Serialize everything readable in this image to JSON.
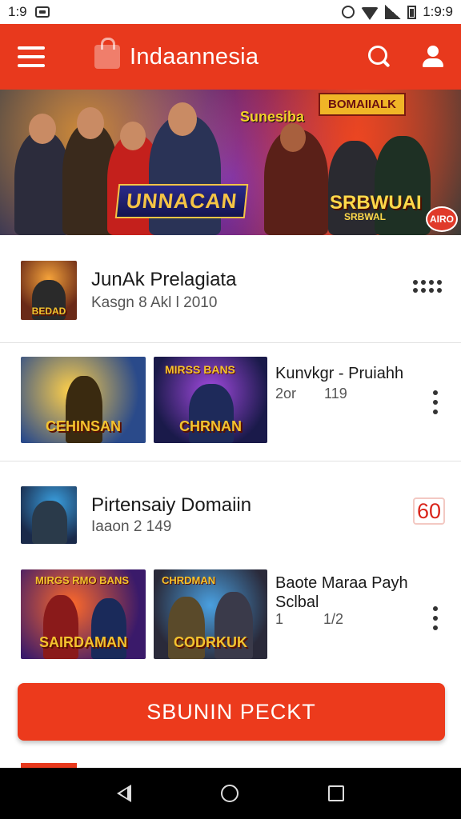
{
  "status_bar": {
    "time_left": "1:9",
    "time_right": "1:9:9"
  },
  "app_bar": {
    "title": "Indaannesia"
  },
  "banner": {
    "logo_text": "UNNACAN",
    "headline": "Sunesiba",
    "panel_text": "BOMAIIALK",
    "title2": "SRBWUAI",
    "subtitle2": "SRBWAL",
    "badge": "AIRO"
  },
  "section1": {
    "title": "JunAk Prelagiata",
    "subtitle": "Kasgn 8  Akl l 2010",
    "thumb_caption": "BEDAD"
  },
  "item1": {
    "title": "Kunvkgr - Pruiahh",
    "meta": "2or       119",
    "thumb_a_caption": "CEHINSAN",
    "thumb_b_top": "MIRSS BANS",
    "thumb_b_caption": "CHRNAN"
  },
  "section2": {
    "title": "Pirtensaiy Domaiin",
    "subtitle": "Iaaon 2 149",
    "count": "60"
  },
  "item2": {
    "title_line1": "Baote Maraa Payh",
    "title_line2": "Sclbal",
    "meta": "1          1/2",
    "thumb_a_top": "MIRGS RMO BANS",
    "thumb_a_caption": "SAIRDAMAN",
    "thumb_b_top": "CHRDMAN",
    "thumb_b_caption": "CODRKUK"
  },
  "cta": {
    "label": "SBUNIN PECKT"
  },
  "colors": {
    "accent": "#e8391d",
    "cta": "#ec3a1c",
    "badge_red": "#d9261c"
  },
  "icons": [
    "menu-icon",
    "lock-icon",
    "search-icon",
    "account-icon",
    "more-vert-icon",
    "apps-dots-icon",
    "back-icon",
    "home-icon",
    "recents-icon"
  ]
}
